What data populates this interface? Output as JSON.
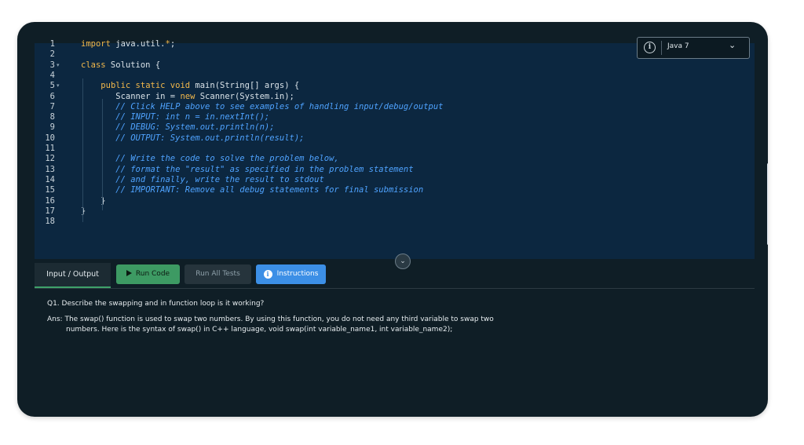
{
  "editor": {
    "line_numbers": [
      "1",
      "2",
      "3",
      "4",
      "5",
      "6",
      "7",
      "8",
      "9",
      "10",
      "11",
      "12",
      "13",
      "14",
      "15",
      "16",
      "17",
      "18"
    ],
    "lines": [
      {
        "segments": [
          {
            "t": "import",
            "c": "kw"
          },
          {
            "t": " java.util.",
            "c": ""
          },
          {
            "t": "*",
            "c": "kw"
          },
          {
            "t": ";",
            "c": ""
          }
        ]
      },
      {
        "segments": []
      },
      {
        "segments": [
          {
            "t": "class",
            "c": "kw"
          },
          {
            "t": " Solution {",
            "c": ""
          }
        ]
      },
      {
        "segments": []
      },
      {
        "segments": [
          {
            "t": "    ",
            "c": ""
          },
          {
            "t": "public static void",
            "c": "kw"
          },
          {
            "t": " main(String[] args) {",
            "c": ""
          }
        ]
      },
      {
        "segments": [
          {
            "t": "       Scanner in = ",
            "c": ""
          },
          {
            "t": "new",
            "c": "kw"
          },
          {
            "t": " Scanner(System.in);",
            "c": ""
          }
        ]
      },
      {
        "segments": [
          {
            "t": "       ",
            "c": ""
          },
          {
            "t": "// Click HELP above to see examples of handling input/debug/output",
            "c": "cm"
          }
        ]
      },
      {
        "segments": [
          {
            "t": "       ",
            "c": ""
          },
          {
            "t": "// INPUT: int n = in.nextInt();",
            "c": "cm"
          }
        ]
      },
      {
        "segments": [
          {
            "t": "       ",
            "c": ""
          },
          {
            "t": "// DEBUG: System.out.println(n);",
            "c": "cm"
          }
        ]
      },
      {
        "segments": [
          {
            "t": "       ",
            "c": ""
          },
          {
            "t": "// OUTPUT: System.out.println(result);",
            "c": "cm"
          }
        ]
      },
      {
        "segments": []
      },
      {
        "segments": [
          {
            "t": "       ",
            "c": ""
          },
          {
            "t": "// Write the code to solve the problem below,",
            "c": "cm"
          }
        ]
      },
      {
        "segments": [
          {
            "t": "       ",
            "c": ""
          },
          {
            "t": "// format the \"result\" as specified in the problem statement",
            "c": "cm"
          }
        ]
      },
      {
        "segments": [
          {
            "t": "       ",
            "c": ""
          },
          {
            "t": "// and finally, write the result to stdout",
            "c": "cm"
          }
        ]
      },
      {
        "segments": [
          {
            "t": "       ",
            "c": ""
          },
          {
            "t": "// IMPORTANT: Remove all debug statements for final submission",
            "c": "cm"
          }
        ]
      },
      {
        "segments": [
          {
            "t": "    }",
            "c": ""
          }
        ]
      },
      {
        "segments": [
          {
            "t": "}",
            "c": ""
          }
        ]
      },
      {
        "segments": []
      }
    ]
  },
  "language_selector": {
    "icon": "info-icon",
    "selected": "Java 7",
    "chevron": "⌄"
  },
  "collapse_button": {
    "icon": "chevron-down-icon",
    "glyph": "⌄"
  },
  "tabs": {
    "input_output": "Input / Output"
  },
  "buttons": {
    "run_code": "Run Code",
    "run_all_tests": "Run All Tests",
    "instructions": "Instructions"
  },
  "panel": {
    "question": "Q1. Describe the swapping and in function loop is it working?",
    "answer_line1": "Ans: The swap() function is used to swap two numbers. By using this function, you do not need any third variable to swap two",
    "answer_line2": "numbers. Here is the syntax of swap() in C++ language, void swap(int variable_name1, int variable_name2);"
  },
  "colors": {
    "keyword": "#f2b84b",
    "comment": "#4fa3ff",
    "run": "#3d9a63",
    "instructions": "#3c8fe6"
  }
}
